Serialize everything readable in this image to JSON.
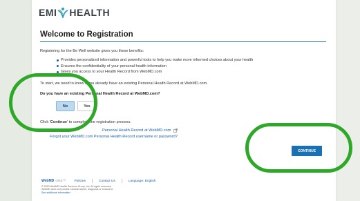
{
  "brand": {
    "left": "EMI",
    "right": "HEALTH"
  },
  "registration": {
    "title": "Welcome to Registration",
    "intro": "Registering for the Be Well website gives you these benefits:",
    "benefits": [
      "Provides personalized information and powerful tools to help you make more informed choices about your health",
      "Ensures the confidentiality of your personal health information",
      "Gives you access to your Health Record from WebMD.com"
    ],
    "start_text": "To start, we need to know if you already have an existing Personal Health Record at WebMD.com.",
    "question": "Do you have an existing Personal Health Record at WebMD.com?",
    "no_label": "No",
    "yes_label": "Yes",
    "click_prefix": "Click '",
    "click_bold": "Continue",
    "click_suffix": "' to complete the registration process.",
    "link_existing": "Personal Health Record at WebMD.com",
    "link_forgot": "Forgot your WebMD.com Personal Health Record username or password?",
    "continue_label": "CONTINUE"
  },
  "footer": {
    "webmd": "WebMD",
    "one": "ONE™",
    "links": [
      "Policies",
      "Contact Us",
      "Language: English"
    ],
    "copyright": "© 2020 WebMD Health Services Group, Inc. All rights reserved.",
    "disclaimer": "WebMD does not provide medical advice, diagnosis or treatment.",
    "see_info": "See additional information."
  },
  "colors": {
    "accent": "#1b6fb3",
    "link": "#1c5fa8",
    "highlight": "#2ea828",
    "selected_button": "#bcd9f0"
  },
  "icons": [
    "emi-health-logo-mark",
    "external-link-icon",
    "bullet-icon"
  ]
}
